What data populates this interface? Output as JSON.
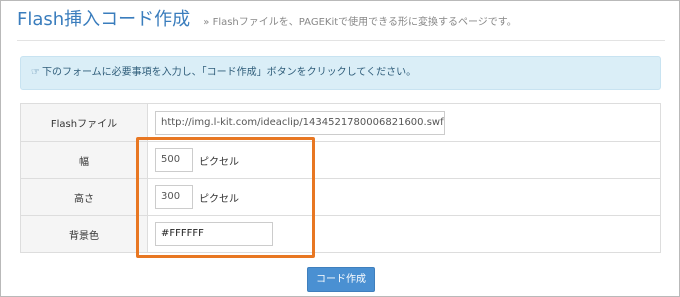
{
  "header": {
    "title": "Flash挿入コード作成",
    "subtitle": "» Flashファイルを、PAGEKitで使用できる形に変換するページです。"
  },
  "notice": {
    "icon": "hand-pointer-icon",
    "text": "下のフォームに必要事項を入力し、「コード作成」ボタンをクリックしてください。"
  },
  "form": {
    "rows": [
      {
        "label": "Flashファイル",
        "value": "http://img.l-kit.com/ideaclip/1434521780006821600.swf",
        "unit": ""
      },
      {
        "label": "幅",
        "value": "500",
        "unit": "ピクセル"
      },
      {
        "label": "高さ",
        "value": "300",
        "unit": "ピクセル"
      },
      {
        "label": "背景色",
        "value": "#FFFFFF",
        "unit": ""
      }
    ]
  },
  "submit": {
    "label": "コード作成"
  },
  "colors": {
    "title": "#3a7dbd",
    "notice_bg": "#daeef7",
    "highlight": "#e87722",
    "button": "#4a90d2"
  }
}
